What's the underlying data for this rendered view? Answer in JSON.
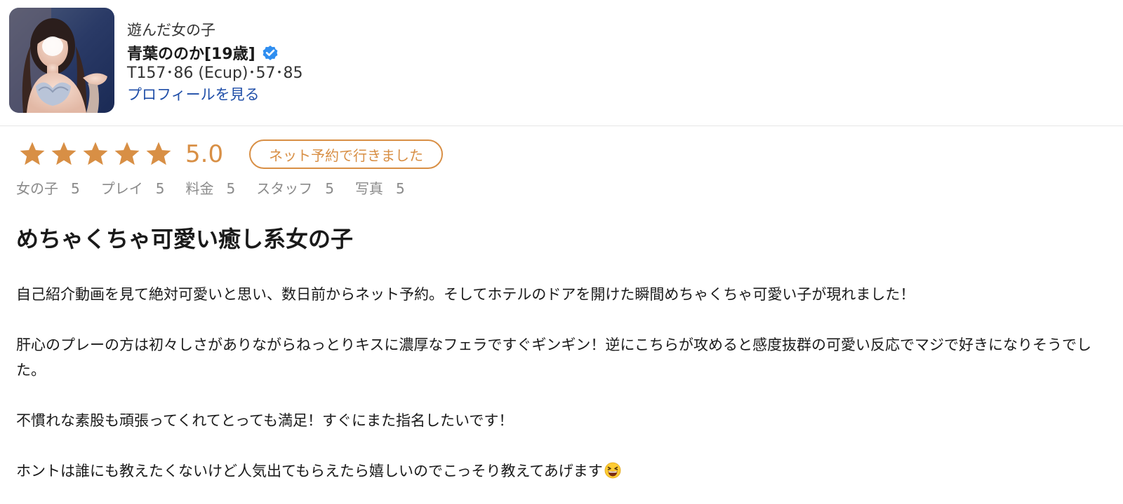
{
  "header": {
    "played_label": "遊んだ女の子",
    "name": "青葉ののか[19歳]",
    "stats": "T157･86 (Ecup)･57･85",
    "profile_link": "プロフィールを見る"
  },
  "rating": {
    "stars_filled": 5,
    "stars_total": 5,
    "score": "5.0",
    "booking_badge": "ネット予約で行きました",
    "accent_color": "#d88f45",
    "subratings": [
      {
        "label": "女の子",
        "value": "5"
      },
      {
        "label": "プレイ",
        "value": "5"
      },
      {
        "label": "料金",
        "value": "5"
      },
      {
        "label": "スタッフ",
        "value": "5"
      },
      {
        "label": "写真",
        "value": "5"
      }
    ]
  },
  "review": {
    "title": "めちゃくちゃ可愛い癒し系女の子",
    "paragraphs": [
      "自己紹介動画を見て絶対可愛いと思い、数日前からネット予約。そしてホテルのドアを開けた瞬間めちゃくちゃ可愛い子が現れました！",
      "肝心のプレーの方は初々しさがありながらねっとりキスに濃厚なフェラですぐギンギン！逆にこちらが攻めると感度抜群の可愛い反応でマジで好きになりそうでした。",
      "不慣れな素股も頑張ってくれてとっても満足！すぐにまた指名したいです！",
      "ホントは誰にも教えたくないけど人気出てもらえたら嬉しいのでこっそり教えてあげます"
    ],
    "trailing_emoji": "grinning-squinting-face-icon"
  },
  "icons": {
    "verified": "verified-badge-icon",
    "star": "star-icon"
  },
  "colors": {
    "link": "#1f4ea8",
    "verified": "#2f8ef0",
    "subrating_text": "#8a8a8a"
  }
}
